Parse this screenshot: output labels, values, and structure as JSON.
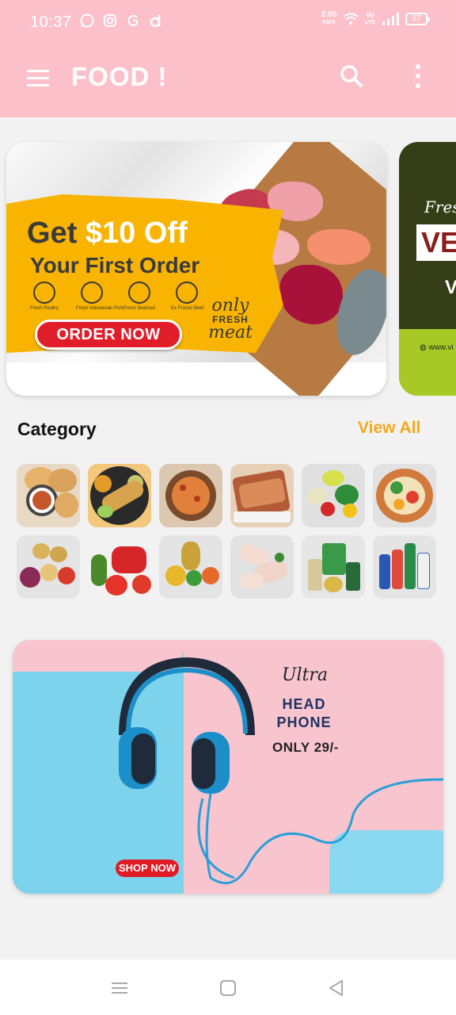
{
  "status_bar": {
    "time": "10:37",
    "net_speed_value": "2.00",
    "net_speed_unit": "KB/S",
    "volte_top": "Vo",
    "volte_bottom": "LTE",
    "battery": "57"
  },
  "app_bar": {
    "title": "FOOD !"
  },
  "banner_main": {
    "headline_prefix": "Get ",
    "headline_amount": "$10 Off",
    "subline": "Your First Order",
    "icon_labels": [
      "Fresh Poultry",
      "Fresh Indonesian Pork",
      "Fresh Seafood",
      "Ex Frozen Beef"
    ],
    "button_label": "ORDER NOW",
    "tag_line1": "only",
    "tag_line2": "FRESH",
    "tag_line3": "meat"
  },
  "banner_next": {
    "script_text": "Fres",
    "big_text": "VEG",
    "letter": "V",
    "url": "www.vi"
  },
  "category": {
    "title": "Category",
    "view_all": "View All"
  },
  "promo": {
    "script": "Ultra",
    "line1": "HEAD",
    "line2": "PHONE",
    "price": "ONLY 29/-",
    "button_label": "SHOP NOW"
  },
  "colors": {
    "app_bar": "#fcc0cb",
    "accent": "#f5a81a",
    "order_button": "#e21d2a"
  }
}
